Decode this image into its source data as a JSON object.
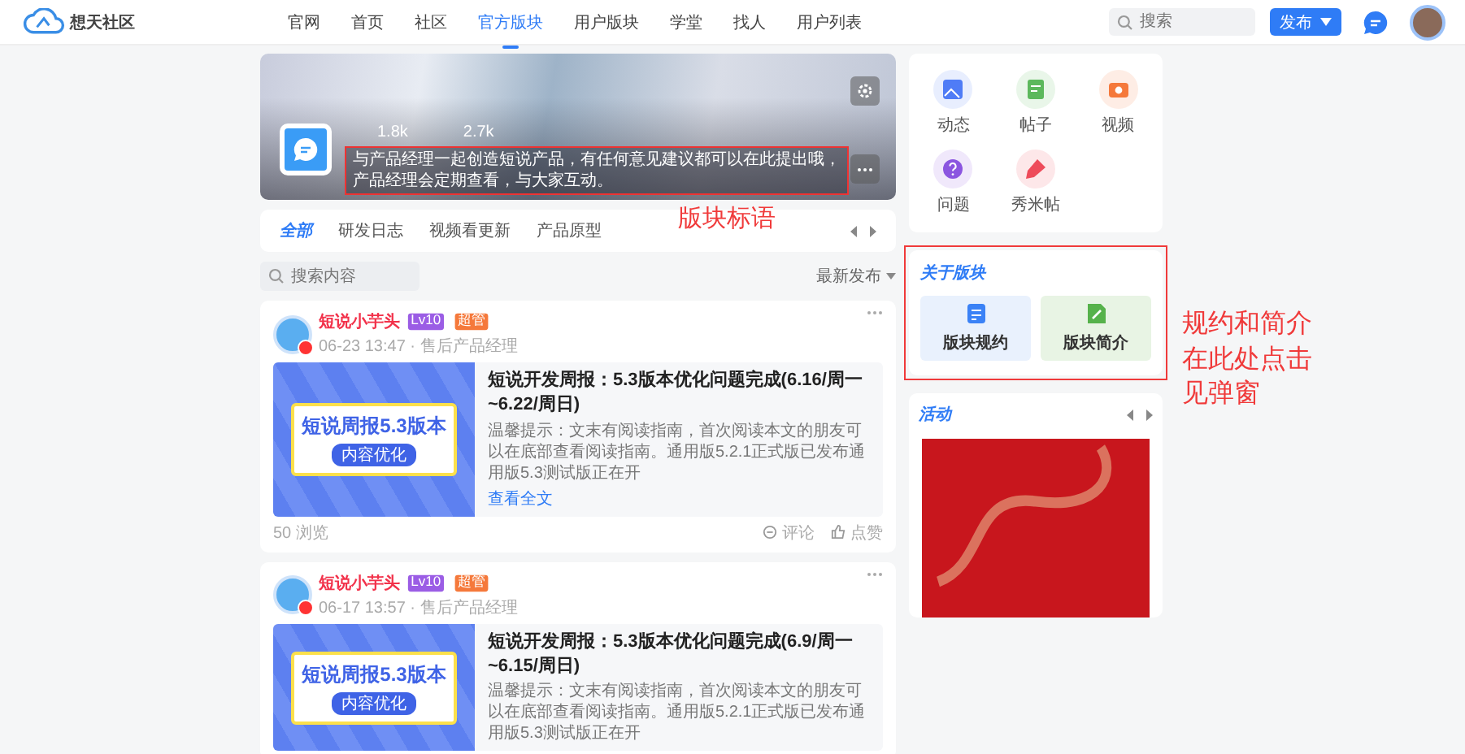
{
  "header": {
    "logo": "想天社区",
    "nav": [
      {
        "label": "官网",
        "selected": false
      },
      {
        "label": "首页",
        "selected": false
      },
      {
        "label": "社区",
        "selected": false
      },
      {
        "label": "官方版块",
        "selected": true
      },
      {
        "label": "用户版块",
        "selected": false
      },
      {
        "label": "学堂",
        "selected": false
      },
      {
        "label": "找人",
        "selected": false
      },
      {
        "label": "用户列表",
        "selected": false
      }
    ],
    "search": {
      "placeholder": "搜索"
    },
    "publish": "发布"
  },
  "banner": {
    "stats": [
      "1.8k",
      "2.7k"
    ],
    "slogan": "与产品经理一起创造短说产品，有任何意见建议都可以在此提出哦，产品经理会定期查看，与大家互动。"
  },
  "tabs": [
    {
      "label": "全部",
      "selected": true
    },
    {
      "label": "研发日志",
      "selected": false
    },
    {
      "label": "视频看更新",
      "selected": false
    },
    {
      "label": "产品原型",
      "selected": false
    }
  ],
  "content_search": {
    "placeholder": "搜索内容"
  },
  "sort": "最新发布",
  "posts": [
    {
      "author": "短说小芋头",
      "level": "Lv10",
      "role": "超管",
      "meta": "06-23 13:47 · 售后产品经理",
      "cover": {
        "title": "短说周报5.3版本",
        "tag": "内容优化"
      },
      "title": "短说开发周报：5.3版本优化问题完成(6.16/周一~6.22/周日)",
      "excerpt": "温馨提示：文末有阅读指南，首次阅读本文的朋友可以在底部查看阅读指南。通用版5.2.1正式版已发布通用版5.3测试版正在开",
      "read_more": "查看全文",
      "views": "50 浏览",
      "comment": "评论",
      "like": "点赞"
    },
    {
      "author": "短说小芋头",
      "level": "Lv10",
      "role": "超管",
      "meta": "06-17 13:57 · 售后产品经理",
      "cover": {
        "title": "短说周报5.3版本",
        "tag": "内容优化"
      },
      "title": "短说开发周报：5.3版本优化问题完成(6.9/周一~6.15/周日)",
      "excerpt": "温馨提示：文末有阅读指南，首次阅读本文的朋友可以在底部查看阅读指南。通用版5.2.1正式版已发布通用版5.3测试版正在开"
    }
  ],
  "quick_entries": [
    {
      "label": "动态",
      "kind": "moment",
      "color": "#4f7cf6"
    },
    {
      "label": "帖子",
      "kind": "post",
      "color": "#5cb85c"
    },
    {
      "label": "视频",
      "kind": "video",
      "color": "#f5793b"
    },
    {
      "label": "问题",
      "kind": "question",
      "color": "#8b55e0"
    },
    {
      "label": "秀米帖",
      "kind": "pen",
      "color": "#ee4b5a"
    }
  ],
  "about": {
    "title": "关于版块",
    "buttons": [
      {
        "label": "版块规约",
        "kind": "rules"
      },
      {
        "label": "版块简介",
        "kind": "intro"
      }
    ]
  },
  "activity": {
    "title": "活动"
  },
  "annotations": [
    "版块标语",
    "规约和简介在此处点击见弹窗"
  ]
}
